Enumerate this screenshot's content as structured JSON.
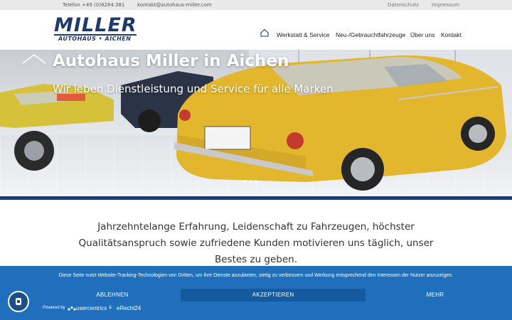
{
  "topbar": {
    "phone": "Telefon +49 (0)8284.381",
    "email": "kontakt@autohaus-miller.com",
    "datenschutz": "Datenschutz",
    "impressum": "Impressum"
  },
  "logo": {
    "word": "MILLER",
    "sub": "AUTOHAUS • AICHEN"
  },
  "nav": {
    "home_icon": "home-icon",
    "items": [
      {
        "label": "Werkstatt & Service"
      },
      {
        "label": "Neu-/Gebrauchtfahrzeuge"
      },
      {
        "label": "Über uns"
      },
      {
        "label": "Kontakt"
      }
    ]
  },
  "hero": {
    "title": "Autohaus Miller in Aichen",
    "subtitle": "Wir leben Dienstleistung und Service für alle Marken",
    "slides": 3,
    "active_slide": 1
  },
  "intro": {
    "text": "Jahrzehntelange Erfahrung, Leidenschaft zu Fahrzeugen, höchster Qualitätsanspruch sowie zufriedene Kunden motivieren uns täglich, unser Bestes zu geben."
  },
  "cookie": {
    "text": "Diese Seite nutzt Website-Tracking-Technologien von Dritten, um ihre Dienste anzubieten, stetig zu verbessern und Werbung entsprechend den Interessen der Nutzer anzuzeigen.",
    "reject_label": "ABLEHNEN",
    "accept_label": "AKZEPTIEREN",
    "more_label": "MEHR",
    "powered_by": "Powered by",
    "usercentrics": "usercentrics",
    "amp": "&",
    "erecht": "eRecht24"
  },
  "colors": {
    "brand_blue": "#1e3a6d",
    "banner_blue": "#1f6fbc",
    "accept_bg": "#155a9e",
    "car_yellow": "#e2b62d"
  }
}
